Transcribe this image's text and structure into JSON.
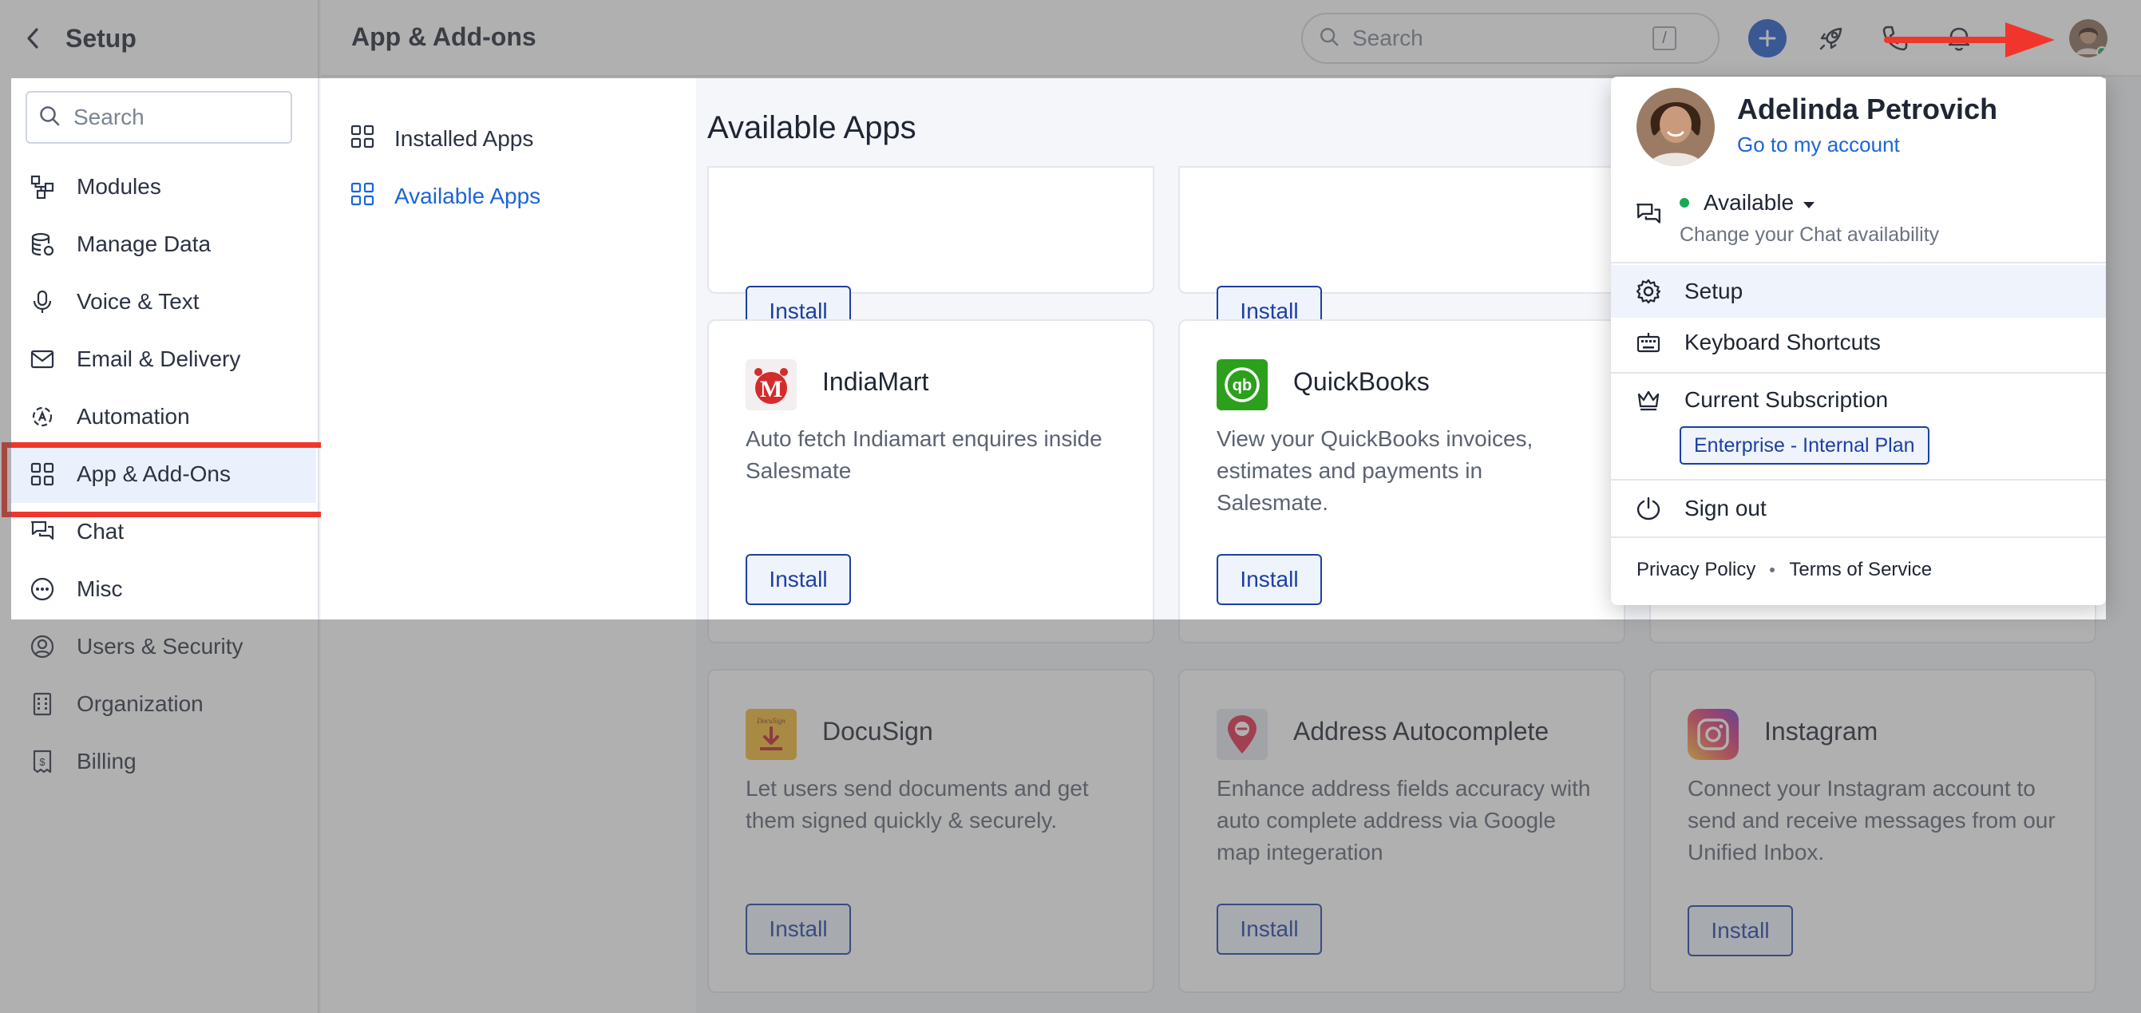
{
  "sidebar": {
    "title": "Setup",
    "search_placeholder": "Search",
    "items": [
      {
        "label": "Modules"
      },
      {
        "label": "Manage Data"
      },
      {
        "label": "Voice & Text"
      },
      {
        "label": "Email & Delivery"
      },
      {
        "label": "Automation"
      },
      {
        "label": "App & Add-Ons"
      },
      {
        "label": "Chat"
      },
      {
        "label": "Misc"
      },
      {
        "label": "Users & Security"
      },
      {
        "label": "Organization"
      },
      {
        "label": "Billing"
      }
    ]
  },
  "header": {
    "title": "App & Add-ons",
    "search_placeholder": "Search",
    "search_shortcut": "/",
    "icons": [
      "plus-icon",
      "rocket-icon",
      "phone-icon",
      "bell-icon",
      "avatar"
    ]
  },
  "subnav": {
    "items": [
      {
        "label": "Installed Apps"
      },
      {
        "label": "Available Apps"
      }
    ]
  },
  "content": {
    "title": "Available Apps",
    "install_label": "Install",
    "apps": [
      {
        "name": "IndiaMart",
        "description": "Auto fetch Indiamart enquires inside Salesmate"
      },
      {
        "name": "QuickBooks",
        "description": "View your QuickBooks invoices, estimates and payments in Salesmate."
      },
      {
        "name": "DocuSign",
        "description": "Let users send documents and get them signed quickly & securely."
      },
      {
        "name": "Address Autocomplete",
        "description": "Enhance address fields accuracy with auto complete address via Google map integeration"
      },
      {
        "name": "Instagram",
        "description": "Connect your Instagram account to send and receive messages from our Unified Inbox."
      }
    ]
  },
  "profile_menu": {
    "name": "Adelinda Petrovich",
    "account_link": "Go to my account",
    "status": "Available",
    "status_sub": "Change your Chat availability",
    "items": [
      {
        "label": "Setup"
      },
      {
        "label": "Keyboard Shortcuts"
      },
      {
        "label": "Current Subscription"
      },
      {
        "label": "Sign out"
      }
    ],
    "plan": "Enterprise - Internal Plan",
    "footer_links": [
      "Privacy Policy",
      "Terms of Service"
    ]
  },
  "colors": {
    "accent": "#1d56c9",
    "link": "#1d64d8",
    "highlight_box": "#f0362c",
    "status_green": "#18a957"
  }
}
